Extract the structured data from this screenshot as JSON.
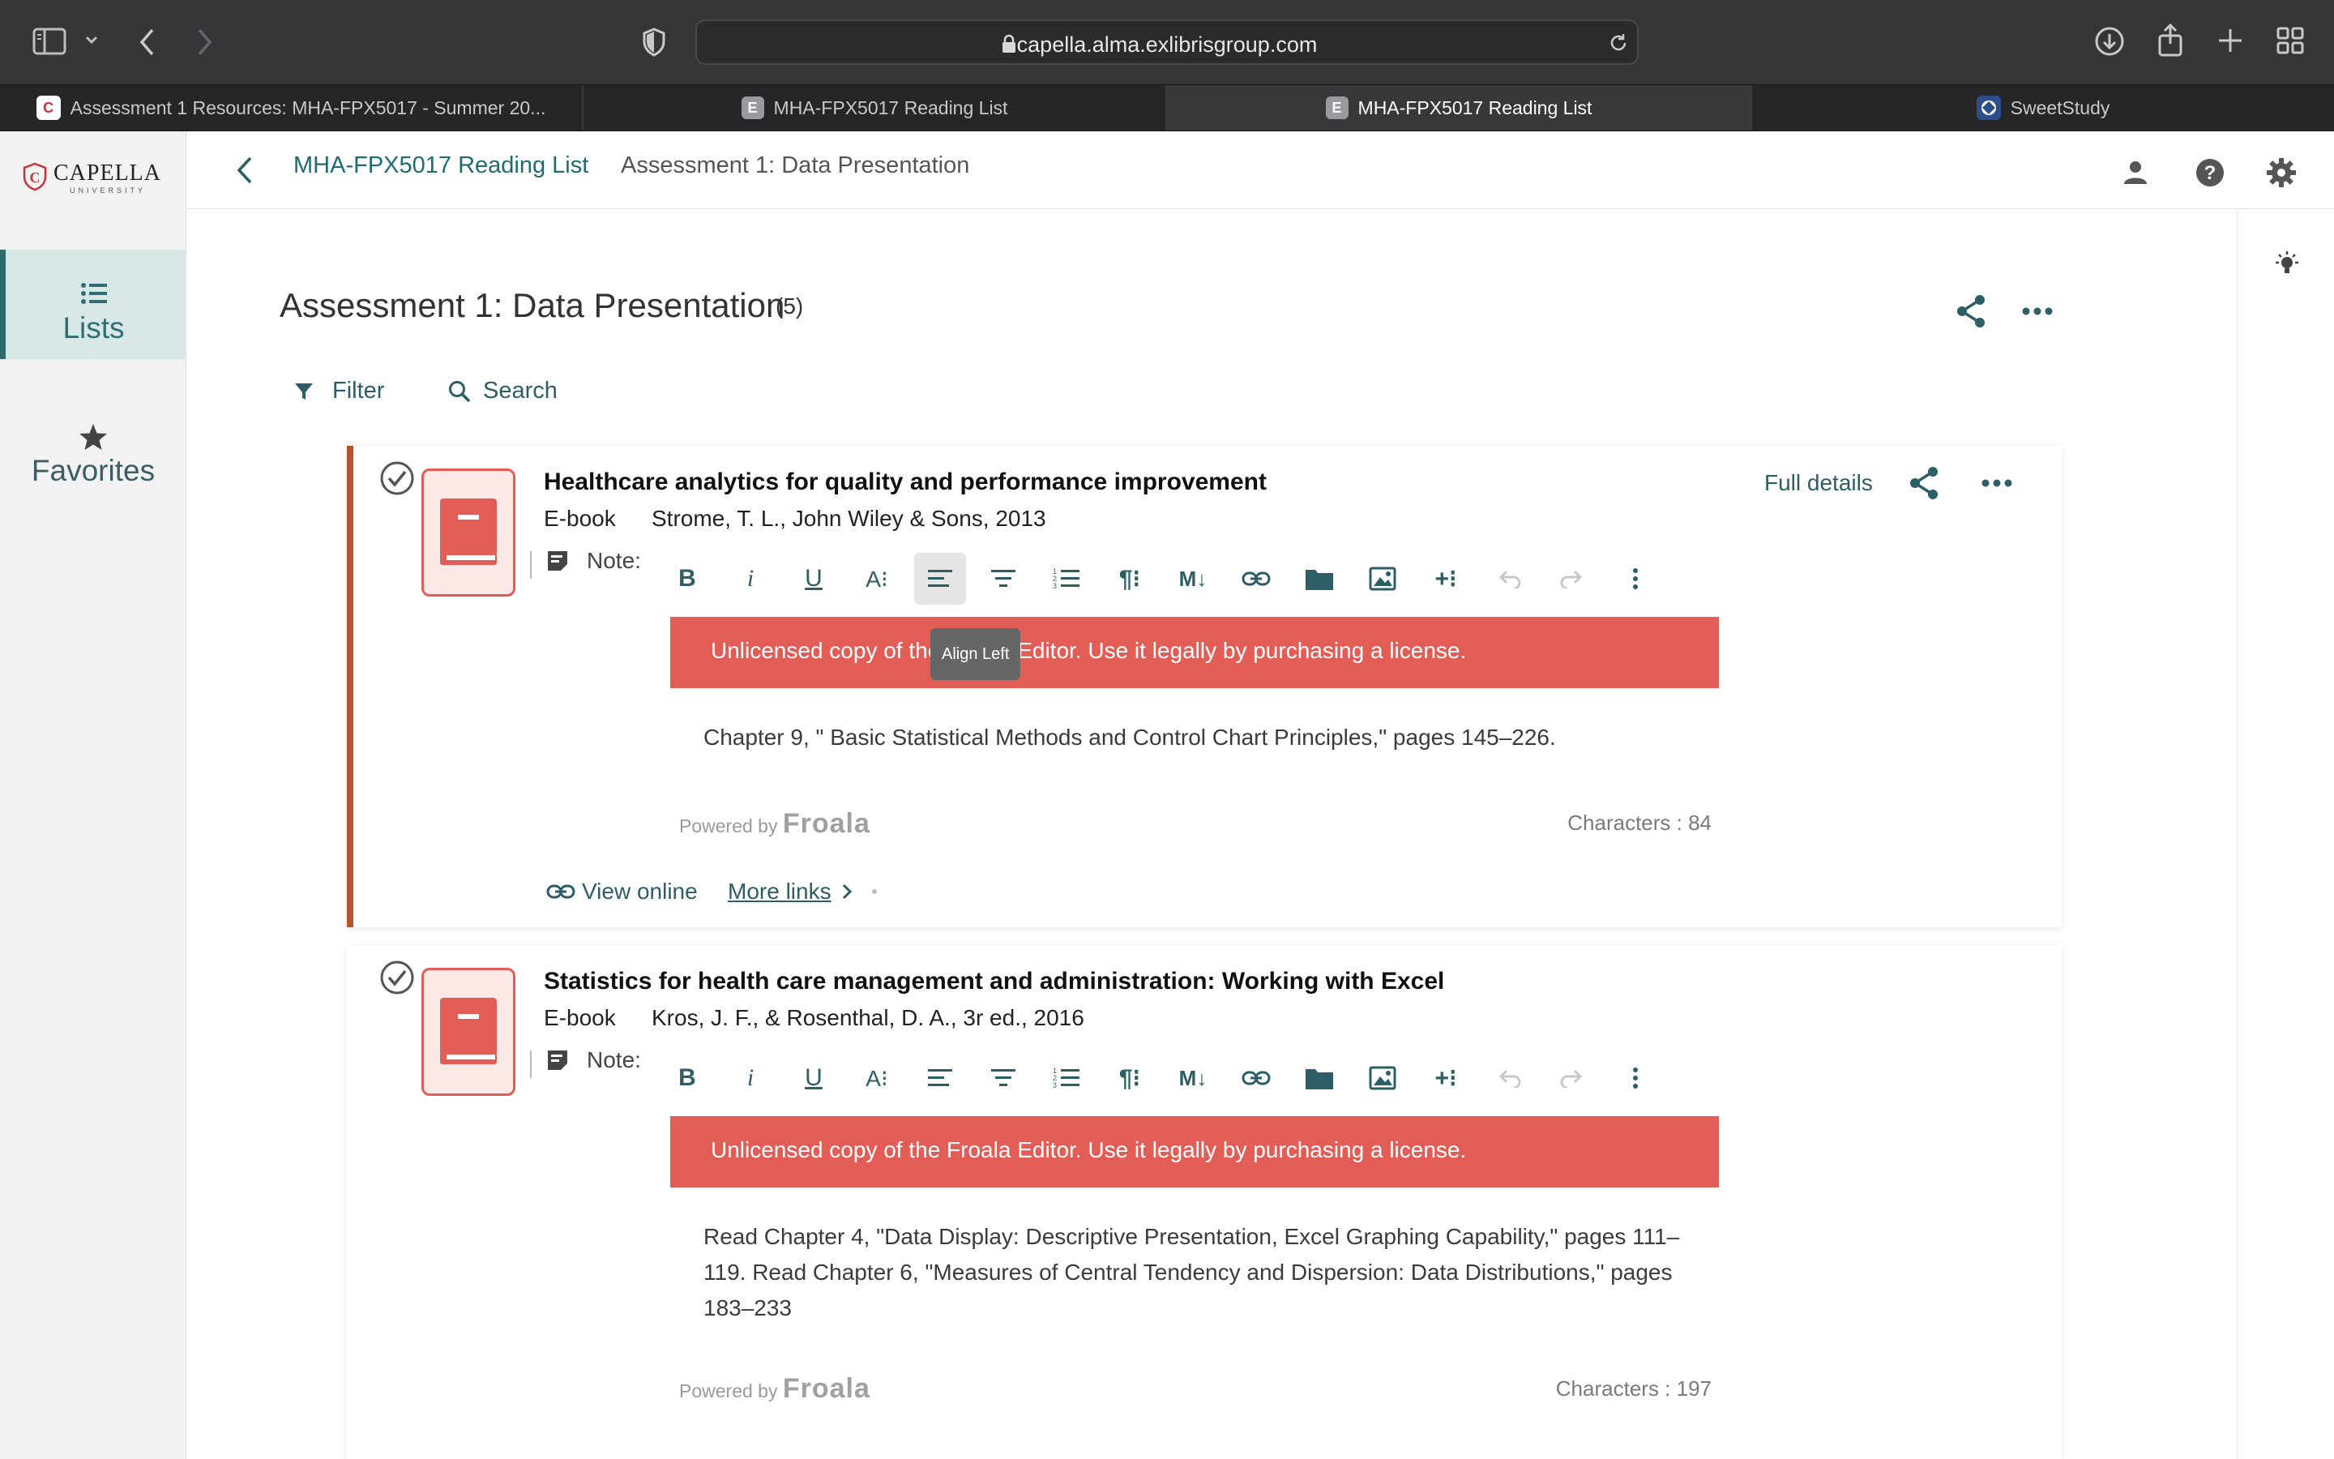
{
  "browser": {
    "url": "capella.alma.exlibrisgroup.com",
    "tabs": [
      {
        "label": "Assessment 1 Resources: MHA-FPX5017 - Summer 20...",
        "favicon": "capella-shield-icon"
      },
      {
        "label": "MHA-FPX5017 Reading List",
        "favicon": "E"
      },
      {
        "label": "MHA-FPX5017 Reading List",
        "favicon": "E",
        "active": true
      },
      {
        "label": "SweetStudy",
        "favicon": "sweetstudy-icon"
      }
    ]
  },
  "sidebar": {
    "logo": {
      "name": "CAPELLA",
      "sub": "UNIVERSITY"
    },
    "items": [
      {
        "label": "Lists",
        "icon": "list-icon",
        "active": true
      },
      {
        "label": "Favorites",
        "icon": "star-icon"
      }
    ]
  },
  "header": {
    "breadcrumb_list": "MHA-FPX5017 Reading List",
    "breadcrumb_section": "Assessment 1: Data Presentation"
  },
  "section": {
    "title": "Assessment 1: Data Presentation",
    "count": "(5)",
    "filter_label": "Filter",
    "search_label": "Search"
  },
  "citations": [
    {
      "title": "Healthcare analytics for quality and performance improvement",
      "type": "E-book",
      "meta": "Strome, T. L., John Wiley & Sons, 2013",
      "note_label": "Note:",
      "warning": "Unlicensed copy of the Froala Editor. Use it legally by purchasing a license.",
      "tooltip": "Align Left",
      "note_text": "Chapter 9, \" Basic Statistical Methods and Control Chart Principles,\" pages 145–226.",
      "powered_by": "Powered by",
      "froala": "Froala",
      "characters": "Characters : 84",
      "full_details": "Full details",
      "view_online": "View online",
      "more_links": "More links"
    },
    {
      "title": "Statistics for health care management and administration: Working with Excel",
      "type": "E-book",
      "meta": "Kros, J. F., & Rosenthal, D. A., 3r ed., 2016",
      "note_label": "Note:",
      "warning": "Unlicensed copy of the Froala Editor. Use it legally by purchasing a license.",
      "note_text_lines": [
        "Read Chapter 4, \"Data Display: Descriptive Presentation, Excel Graphing Capability,\" pages 111–",
        "119. Read Chapter 6, \"Measures of Central Tendency and Dispersion: Data Distributions,\" pages",
        "183–233"
      ],
      "powered_by": "Powered by",
      "froala": "Froala",
      "characters": "Characters : 197"
    }
  ],
  "colors": {
    "accent": "#2d5d65",
    "warning": "#e35d57",
    "book": "#e35d57",
    "card_marker": "#b5532c"
  }
}
